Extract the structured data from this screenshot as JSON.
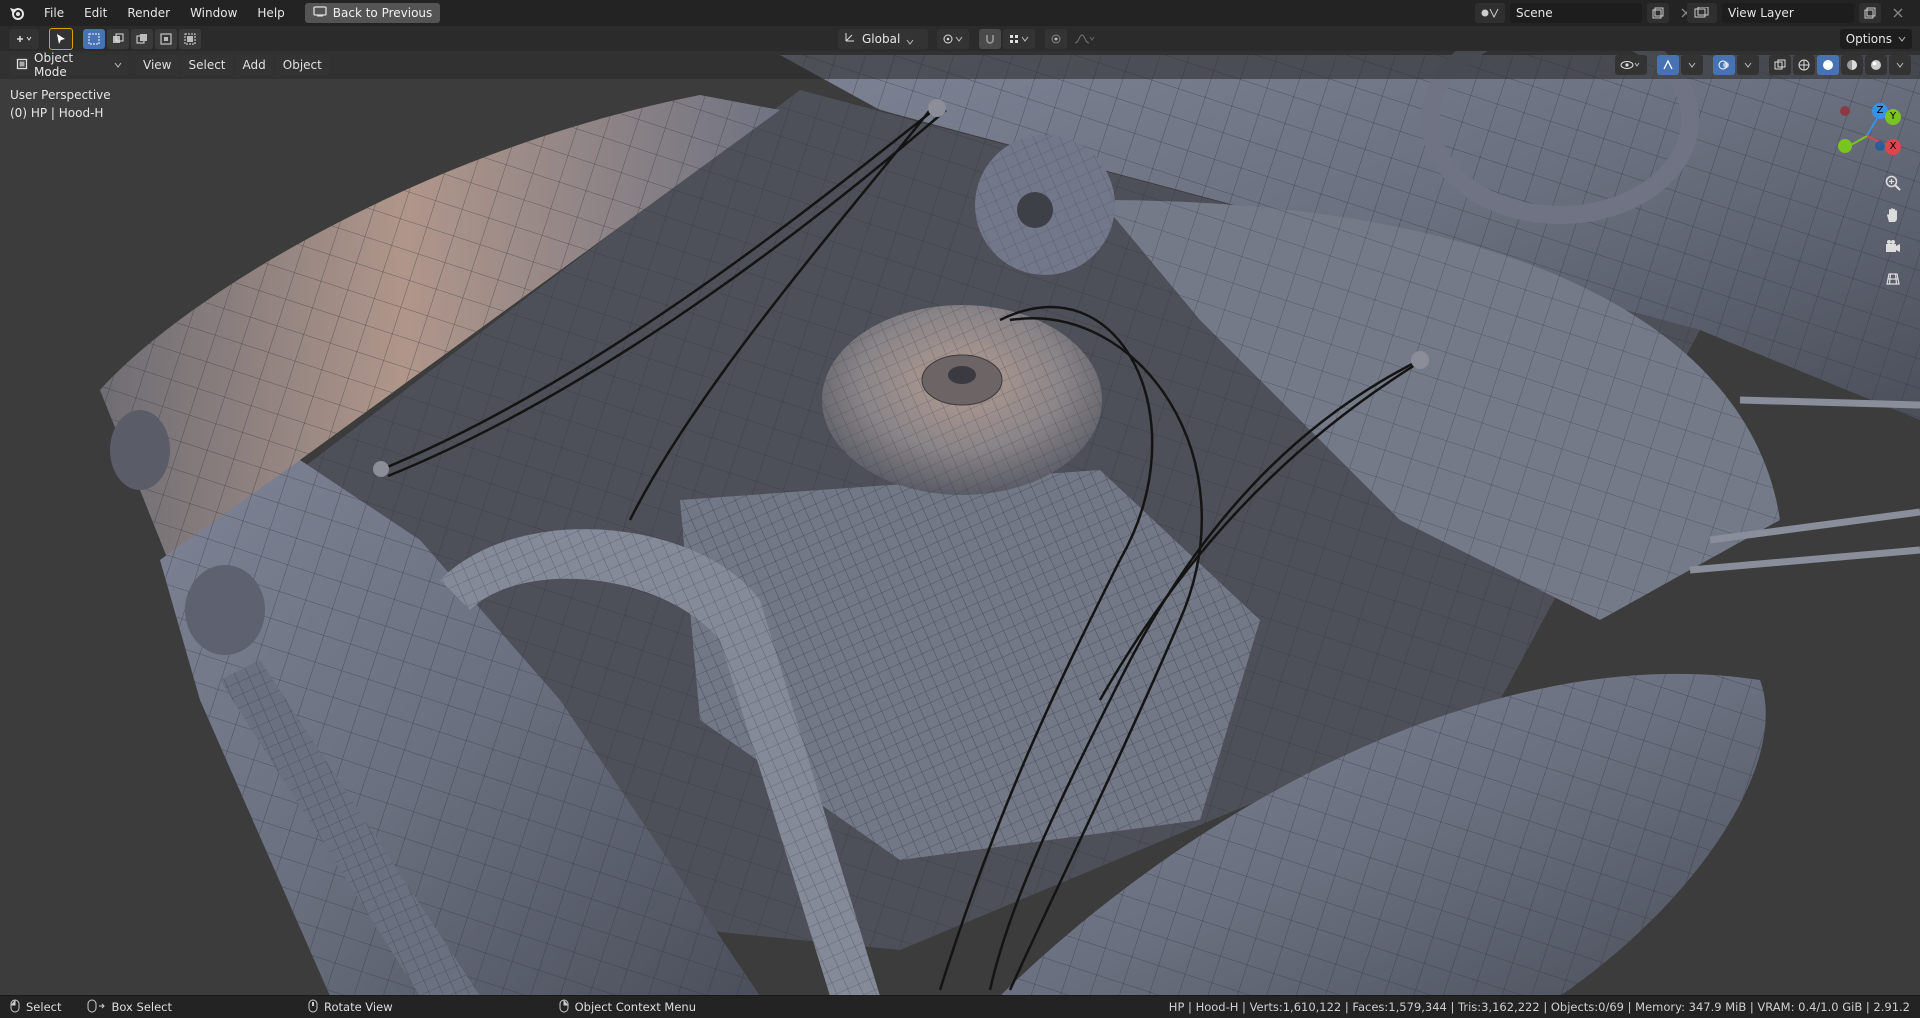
{
  "topbar": {
    "menus": [
      "File",
      "Edit",
      "Render",
      "Window",
      "Help"
    ],
    "back_button": "Back to Previous",
    "scene_name": "Scene",
    "view_layer": "View Layer"
  },
  "toolbar": {
    "orientation": "Global",
    "options_label": "Options"
  },
  "header": {
    "mode": "Object Mode",
    "menus": [
      "View",
      "Select",
      "Add",
      "Object"
    ]
  },
  "viewport": {
    "perspective": "User Perspective",
    "active_object": "(0) HP | Hood-H"
  },
  "gizmo": {
    "z": "Z",
    "y": "Y",
    "x": "X"
  },
  "statusbar": {
    "select": "Select",
    "box_select": "Box Select",
    "rotate": "Rotate View",
    "context_menu": "Object Context Menu",
    "stats": "HP | Hood-H | Verts:1,610,122 | Faces:1,579,344 | Tris:3,162,222 | Objects:0/69 | Memory: 347.9 MiB | VRAM: 0.4/1.0 GiB | 2.91.2"
  },
  "colors": {
    "accent": "#4772b3",
    "axis_x": "#e0444f",
    "axis_y": "#7ac422",
    "axis_z": "#3a8fe6"
  }
}
